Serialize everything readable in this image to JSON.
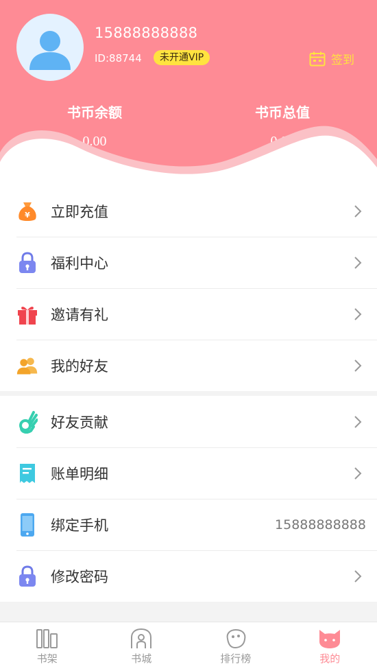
{
  "user": {
    "phone": "15888888888",
    "id_text": "ID:88744",
    "vip_badge": "未开通VIP",
    "signin_label": "签到"
  },
  "stats": [
    {
      "label": "书币余额",
      "value": "0.00"
    },
    {
      "label": "书币总值",
      "value": "0.00"
    }
  ],
  "menu_group1": [
    {
      "label": "立即充值",
      "icon": "money-bag-icon"
    },
    {
      "label": "福利中心",
      "icon": "lock-icon"
    },
    {
      "label": "邀请有礼",
      "icon": "gift-icon"
    },
    {
      "label": "我的好友",
      "icon": "friends-icon"
    }
  ],
  "menu_group2": [
    {
      "label": "好友贡献",
      "icon": "hand-ok-icon"
    },
    {
      "label": "账单明细",
      "icon": "receipt-icon"
    },
    {
      "label": "绑定手机",
      "icon": "mobile-phone-icon",
      "value": "15888888888"
    },
    {
      "label": "修改密码",
      "icon": "lock-icon"
    }
  ],
  "tabbar": [
    {
      "label": "书架",
      "icon": "bookshelf-icon",
      "active": false
    },
    {
      "label": "书城",
      "icon": "bookstore-icon",
      "active": false
    },
    {
      "label": "排行榜",
      "icon": "ranking-icon",
      "active": false
    },
    {
      "label": "我的",
      "icon": "cat-face-icon",
      "active": true
    }
  ],
  "colors": {
    "header_pink": "#fe8b95",
    "vip_yellow": "#ffe33f",
    "active_tab": "#fe8b95"
  }
}
